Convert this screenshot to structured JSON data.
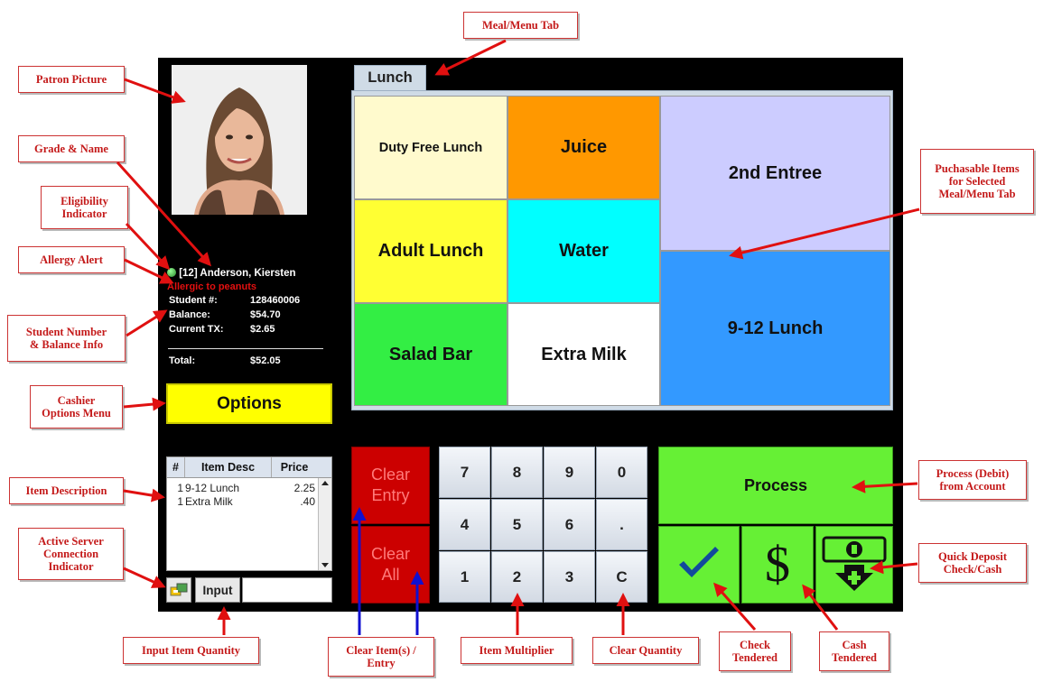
{
  "callouts": {
    "meal_menu_tab": "Meal/Menu Tab",
    "patron_picture": "Patron Picture",
    "grade_name": "Grade & Name",
    "eligibility": "Eligibility\nIndicator",
    "allergy_alert": "Allergy Alert",
    "student_balance": "Student Number\n& Balance Info",
    "cashier_options": "Cashier\nOptions Menu",
    "item_description": "Item Description",
    "server_indicator": "Active Server\nConnection\nIndicator",
    "input_quantity": "Input Item Quantity",
    "clear_items": "Clear Item(s) /\nEntry",
    "item_multiplier": "Item Multiplier",
    "clear_quantity": "Clear Quantity",
    "check_tendered": "Check\nTendered",
    "cash_tendered": "Cash\nTendered",
    "quick_deposit": "Quick Deposit\nCheck/Cash",
    "process_debit": "Process (Debit)\nfrom Account",
    "purchasable_items": "Puchasable Items\nfor Selected\nMeal/Menu Tab"
  },
  "patron": {
    "grade_name": "[12] Anderson, Kiersten",
    "allergy": "Allergic to peanuts",
    "student_label": "Student #:",
    "student_number": "128460006",
    "balance_label": "Balance:",
    "balance": "$54.70",
    "current_tx_label": "Current TX:",
    "current_tx": "$2.65",
    "total_label": "Total:",
    "total": "$52.05"
  },
  "options_label": "Options",
  "item_list": {
    "headers": [
      "#",
      "Item Desc",
      "Price"
    ],
    "rows": [
      {
        "qty": "1",
        "desc": "9-12 Lunch",
        "price": "2.25"
      },
      {
        "qty": "1",
        "desc": "Extra Milk",
        "price": ".40"
      }
    ]
  },
  "input_label": "Input",
  "input_value": "",
  "tab_label": "Lunch",
  "menu_items": [
    {
      "label": "Duty Free Lunch",
      "color": "#fffacd"
    },
    {
      "label": "Juice",
      "color": "#ff9800"
    },
    {
      "label": "2nd Entree",
      "color": "#ccccff"
    },
    {
      "label": "Adult Lunch",
      "color": "#ffff33"
    },
    {
      "label": "Water",
      "color": "#00ffff"
    },
    {
      "label": "9-12 Lunch",
      "color": "#3399ff"
    },
    {
      "label": "Salad Bar",
      "color": "#33ee44"
    },
    {
      "label": "Extra Milk",
      "color": "#ffffff"
    }
  ],
  "clear_entry_label": "Clear\nEntry",
  "clear_all_label": "Clear\nAll",
  "keypad": [
    "7",
    "8",
    "9",
    "0",
    "4",
    "5",
    "6",
    ".",
    "1",
    "2",
    "3",
    "C"
  ],
  "process_label": "Process",
  "cash_symbol": "$",
  "icons": [
    "check-icon",
    "dollar-icon",
    "quick-deposit-icon",
    "server-connection-icon",
    "globe-icon"
  ],
  "colors": {
    "accent_red": "#c41a1a",
    "process_green": "#66f035",
    "options_yellow": "#ffff00",
    "clear_red": "#cc0000"
  }
}
